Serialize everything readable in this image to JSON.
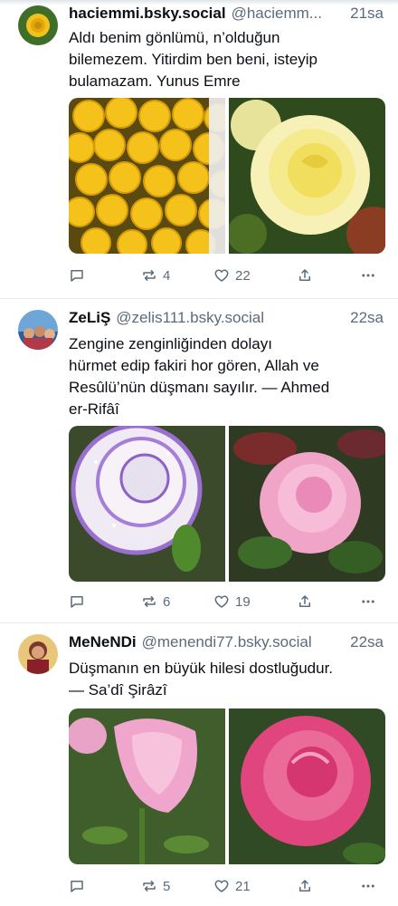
{
  "posts": [
    {
      "display_name": "haciemmi.bsky.social",
      "handle": "@haciemm...",
      "time": "21sa",
      "text_lines": [
        "Aldı benim gönlümü, n’olduğun",
        "bilemezem. Yitirdim ben beni, isteyip",
        "bulamazam. Yunus Emre"
      ],
      "reposts": "4",
      "likes": "22",
      "images": [
        "yellow-roses-bouquet",
        "yellow-rose"
      ]
    },
    {
      "display_name": "ZeLiŞ",
      "handle": "@zelis111.bsky.social",
      "time": "22sa",
      "text_lines": [
        "Zengine zenginliğinden dolayı",
        "hürmet edip fakiri hor gören, Allah ve",
        "Resûlü’nün düşmanı sayılır. — Ahmed",
        "er-Rifâî"
      ],
      "reposts": "6",
      "likes": "19",
      "images": [
        "white-purple-rose",
        "pink-rose"
      ]
    },
    {
      "display_name": "MeNeNDi",
      "handle": "@menendi77.bsky.social",
      "time": "22sa",
      "text_lines": [
        "Düşmanın en büyük hilesi dostluğudur.",
        "— Sa’dî Şirâzî"
      ],
      "reposts": "5",
      "likes": "21",
      "images": [
        "pink-rose-bud",
        "magenta-rose"
      ]
    }
  ],
  "icons": {
    "reply": "speech-bubble-icon",
    "repost": "repost-arrows-icon",
    "like": "heart-icon",
    "share": "share-icon",
    "more": "ellipsis-icon"
  },
  "colors": {
    "text": "#0b0f14",
    "muted": "#5a6b7b",
    "divider": "#e6eaee"
  }
}
